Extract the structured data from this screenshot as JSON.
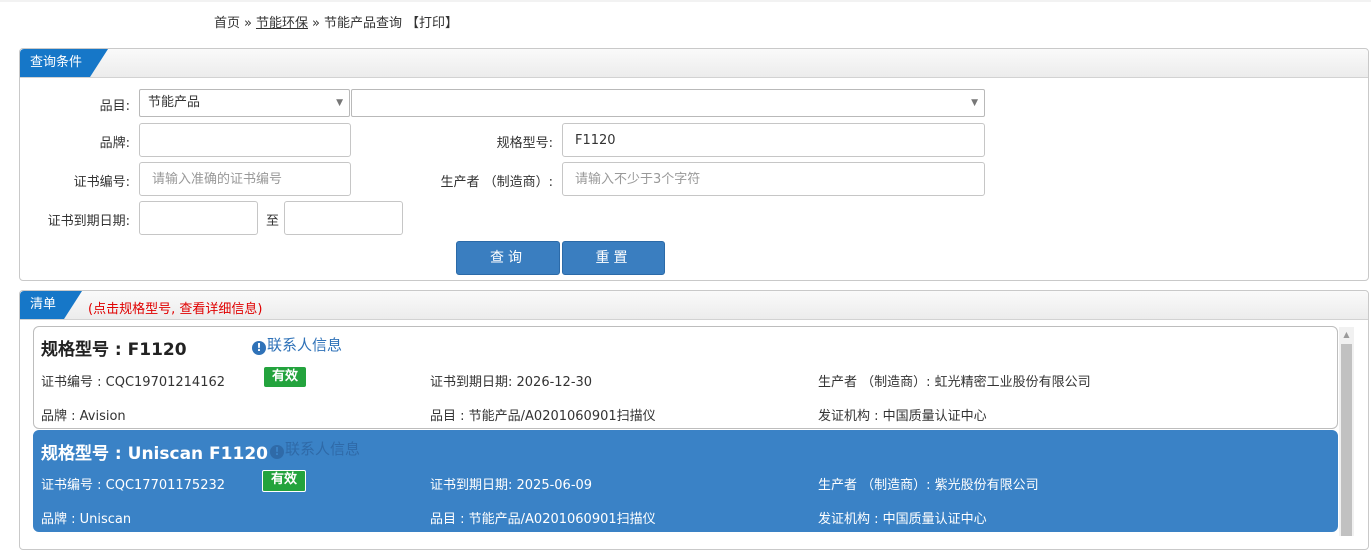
{
  "breadcrumb": {
    "home": "首页",
    "sep": "»",
    "section": "节能环保",
    "current": "节能产品查询",
    "print": "【打印】"
  },
  "query": {
    "header": "查询条件",
    "category_label": "品目:",
    "category_value": "节能产品",
    "subcategory_value": "",
    "brand_label": "品牌:",
    "brand_value": "",
    "model_label": "规格型号:",
    "model_value": "F1120",
    "cert_label": "证书编号:",
    "cert_placeholder": "请输入准确的证书编号",
    "maker_label": "生产者 （制造商）:",
    "maker_placeholder": "请输入不少于3个字符",
    "expiry_label": "证书到期日期:",
    "expiry_from": "",
    "expiry_to": "",
    "range_sep": "至",
    "search_button": "查询",
    "reset_button": "重置"
  },
  "list": {
    "header": "清单",
    "hint": "(点击规格型号, 查看详细信息)",
    "results": [
      {
        "title": "规格型号 : F1120",
        "contact": "联系人信息",
        "cert": "证书编号 : CQC19701214162",
        "status": "有效",
        "expiry": "证书到期日期: 2026-12-30",
        "maker": "生产者 （制造商）: 虹光精密工业股份有限公司",
        "brand": "品牌 : Avision",
        "category": "品目 : 节能产品/A0201060901扫描仪",
        "issuer": "发证机构 : 中国质量认证中心"
      },
      {
        "title": "规格型号 : Uniscan F1120",
        "contact": "联系人信息",
        "cert": "证书编号 : CQC17701175232",
        "status": "有效",
        "expiry": "证书到期日期: 2025-06-09",
        "maker": "生产者 （制造商）: 紫光股份有限公司",
        "brand": "品牌 : Uniscan",
        "category": "品目 : 节能产品/A0201060901扫描仪",
        "issuer": "发证机构 : 中国质量认证中心"
      }
    ]
  },
  "colors": {
    "accent": "#1677c8",
    "button": "#3a7ec0",
    "selected_row": "#3a82c6",
    "valid_badge": "#23a33d",
    "hint": "#e00000"
  }
}
